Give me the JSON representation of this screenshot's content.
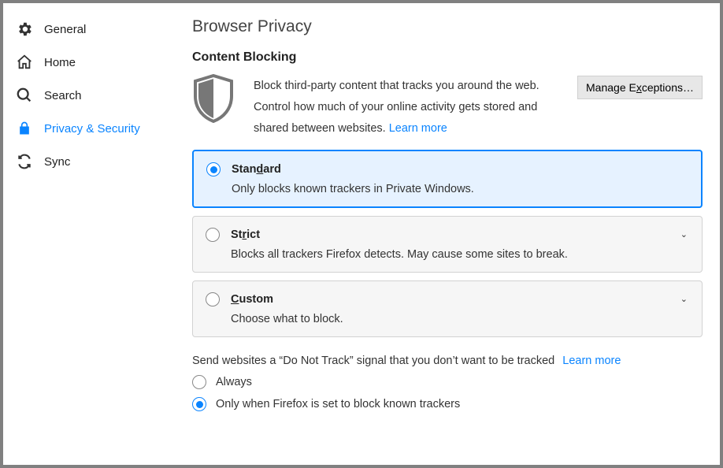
{
  "sidebar": {
    "items": [
      {
        "label": "General"
      },
      {
        "label": "Home"
      },
      {
        "label": "Search"
      },
      {
        "label": "Privacy & Security"
      },
      {
        "label": "Sync"
      }
    ]
  },
  "page": {
    "title": "Browser Privacy"
  },
  "content_blocking": {
    "heading": "Content Blocking",
    "description": "Block third-party content that tracks you around the web. Control how much of your online activity gets stored and shared between websites.  ",
    "learn_more": "Learn more",
    "manage_exceptions": "Manage Exceptions…"
  },
  "modes": {
    "standard": {
      "title_pre": "Stan",
      "title_u": "d",
      "title_post": "ard",
      "desc": "Only blocks known trackers in Private Windows."
    },
    "strict": {
      "title_pre": "St",
      "title_u": "r",
      "title_post": "ict",
      "desc": "Blocks all trackers Firefox detects. May cause some sites to break."
    },
    "custom": {
      "title_pre": "",
      "title_u": "C",
      "title_post": "ustom",
      "desc": "Choose what to block."
    }
  },
  "dnt": {
    "text": "Send websites a “Do Not Track” signal that you don’t want to be tracked",
    "learn_more": "Learn more",
    "always": "Always",
    "only_when": "Only when Firefox is set to block known trackers"
  }
}
